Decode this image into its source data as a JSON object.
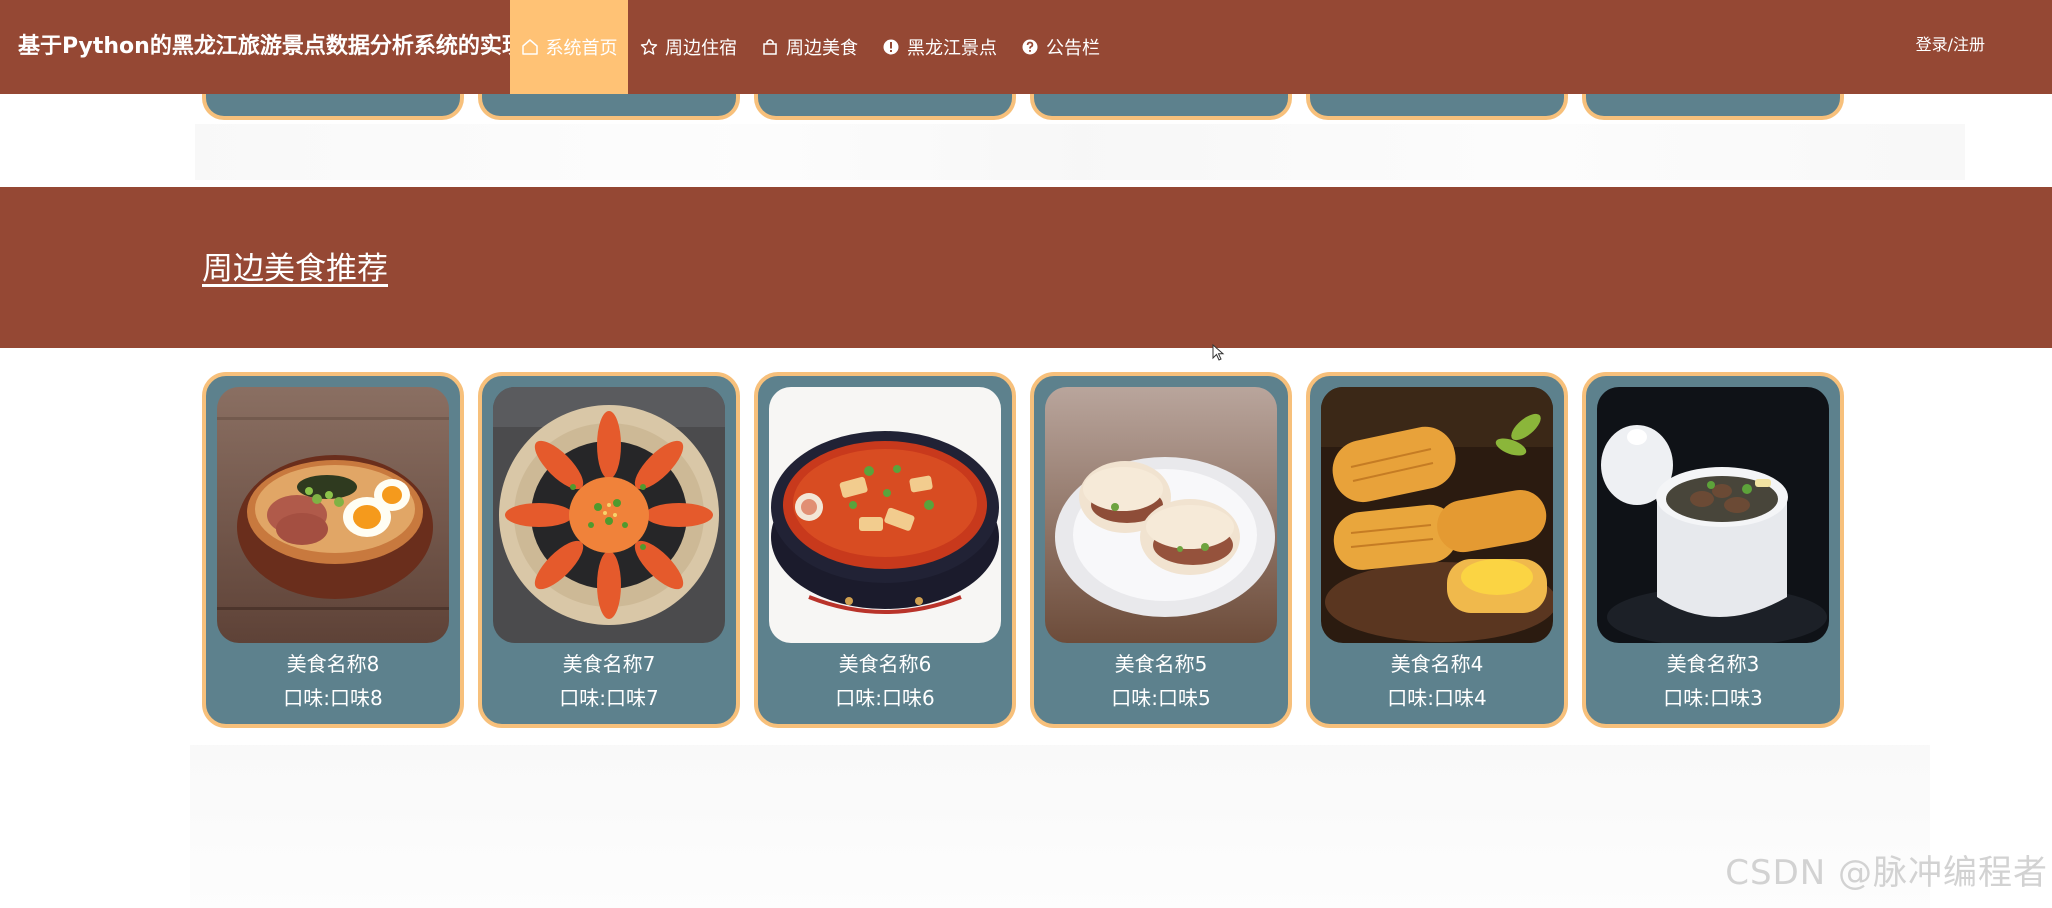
{
  "header": {
    "site_title": "基于Python的黑龙江旅游景点数据分析系统的实现",
    "nav": [
      {
        "label": "系统首页",
        "icon": "home-icon",
        "active": true
      },
      {
        "label": "周边住宿",
        "icon": "star-icon",
        "active": false
      },
      {
        "label": "周边美食",
        "icon": "bag-icon",
        "active": false
      },
      {
        "label": "黑龙江景点",
        "icon": "info-circle-icon",
        "active": false
      },
      {
        "label": "公告栏",
        "icon": "question-circle-icon",
        "active": false
      }
    ],
    "login_label": "登录/注册"
  },
  "colors": {
    "brand": "#954834",
    "active_nav": "#ffc275",
    "card_bg": "#5d818d",
    "card_border": "#f7c07b"
  },
  "food_section": {
    "title": "周边美食推荐",
    "items": [
      {
        "name": "美食名称8",
        "taste": "口味:口味8",
        "image": "ramen-bowl"
      },
      {
        "name": "美食名称7",
        "taste": "口味:口味7",
        "image": "shrimp-plate"
      },
      {
        "name": "美食名称6",
        "taste": "口味:口味6",
        "image": "spicy-soup-bowl"
      },
      {
        "name": "美食名称5",
        "taste": "口味:口味5",
        "image": "stuffed-buns"
      },
      {
        "name": "美食名称4",
        "taste": "口味:口味4",
        "image": "golden-pastries"
      },
      {
        "name": "美食名称3",
        "taste": "口味:口味3",
        "image": "stew-pot"
      }
    ]
  },
  "watermark": "CSDN @脉冲编程者"
}
